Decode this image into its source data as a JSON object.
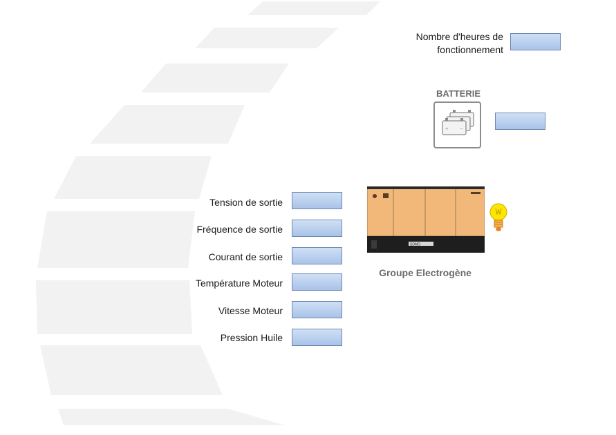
{
  "hours": {
    "label": "Nombre d'heures de fonctionnement",
    "value": ""
  },
  "battery": {
    "title": "BATTERIE",
    "value": "",
    "icon": "battery-icon"
  },
  "generator": {
    "caption": "Groupe Electrogène",
    "icon": "generator-icon",
    "status_icon": "lightbulb-icon",
    "brand": "SDMO"
  },
  "measures": [
    {
      "label": "Tension de sortie",
      "value": ""
    },
    {
      "label": "Fréquence de sortie",
      "value": ""
    },
    {
      "label": "Courant de sortie",
      "value": ""
    },
    {
      "label": "Température Moteur",
      "value": ""
    },
    {
      "label": "Vitesse Moteur",
      "value": ""
    },
    {
      "label": "Pression Huile",
      "value": ""
    }
  ],
  "colors": {
    "stripe": "#f2f2f2",
    "box_top": "#cfe0f5",
    "box_bottom": "#a9c3e8",
    "box_border": "#6b86b4",
    "generator_body": "#f1b87a"
  }
}
